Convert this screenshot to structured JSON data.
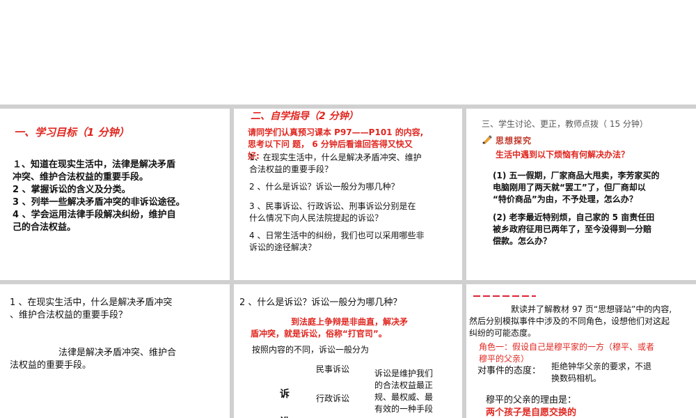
{
  "p1": {
    "title": "一、学习目标（1 分钟）",
    "goals": [
      "１、知道在现实生活中，法律是解决矛盾",
      "冲突、维护合法权益的重要手段。",
      "2 、掌握诉讼的含义及分类。",
      "3 、列举一些解决矛盾冲突的非诉讼途径。",
      "4 、学会运用法律手段解决纠纷，维护自",
      "己的合法权益。"
    ]
  },
  "p2": {
    "title": "二、自学指导（2 分钟）",
    "instruction": [
      "请同学们认真预习课本 P97——P101 的内容,",
      "思考以下问 题， 6 分钟后看谁回答得又快又",
      "好:"
    ],
    "questions": [
      [
        "1、在现实生活中，什么是解决矛盾冲突、维护",
        "合法权益的重要手段？"
      ],
      [
        "2 、什么是诉讼？诉讼一般分为哪几种？"
      ],
      [
        "3 、民事诉讼、行政诉讼、刑事诉讼分别是在",
        "什么情况下向人民法院提起的诉讼？"
      ],
      [
        "4 、日常生活中的纠纷，我们也可以采用哪些非",
        "诉讼的途径解决？"
      ]
    ]
  },
  "p3": {
    "header": "三、学生讨论、更正，教师点拨（ 15 分钟）",
    "badge": "思想探究",
    "subtitle": "生活中遇到以下烦恼有何解决办法？",
    "case1": [
      "(1) 五一假期，厂家商品大甩卖，李芳家买的",
      "电脑刚用了两天就“罢工”了，但厂商却以",
      "“特价商品”为由，不予处理，怎么办？"
    ],
    "case2": [
      "(2) 老李最近特别烦，自己家的 5 亩责任田",
      "被乡政府征用已两年了，至今没得到一分赔",
      "偿款。怎么办？"
    ]
  },
  "p4": {
    "question": [
      "1 、在现实生活中，什么是解决矛盾冲突",
      "、维护合法权益的重要手段？"
    ],
    "answer": [
      "法律是解决矛盾冲突、维护合",
      "法权益的重要手段。"
    ]
  },
  "p5": {
    "question": "2 、什么是诉讼？诉讼一般分为哪几种？",
    "definition": [
      "到法庭上争辩是非曲直，解决矛",
      "盾冲突，就是诉讼，俗称“打官司”。"
    ],
    "classify": "按照内容的不同，诉讼一般分为",
    "vertical_label": "诉讼",
    "types": [
      "民事诉讼",
      "行政诉讼"
    ],
    "note": [
      "诉讼是维护我们",
      "的合法权益最正",
      "规、最权威、最",
      "有效的一种手段"
    ]
  },
  "p6": {
    "intro": [
      "默读并了解教材 97 页“思想驿站”中的内容,",
      "然后分别模拟事件中涉及的不同角色，设想他们对这起",
      "纠纷的可能态度。"
    ],
    "role": [
      "角色一：假设自己是穆平家的一方（穆平、或者",
      "穆平的父亲）"
    ],
    "attitude_label": "对事件的态度：",
    "attitude": [
      "拒绝钟华父亲的要求，不退",
      "换数码相机。"
    ],
    "reason_label": "穆平的父亲的理由是：",
    "reason": "两个孩子是自愿交换的"
  }
}
